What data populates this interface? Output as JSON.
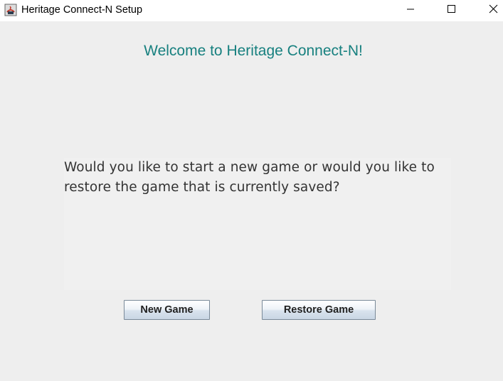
{
  "window": {
    "title": "Heritage Connect-N Setup",
    "icon": "java-cup-icon",
    "controls": {
      "minimize": "minimize-icon",
      "maximize": "maximize-icon",
      "close": "close-icon"
    }
  },
  "content": {
    "welcome": "Welcome to Heritage Connect-N!",
    "message": "Would you like to start a new game or would you like to restore the game that is currently saved?",
    "new_game_label": "New Game",
    "restore_game_label": "Restore Game"
  },
  "colors": {
    "welcome_text": "#17807f",
    "background": "#eeeeee",
    "titlebar": "#ffffff"
  }
}
